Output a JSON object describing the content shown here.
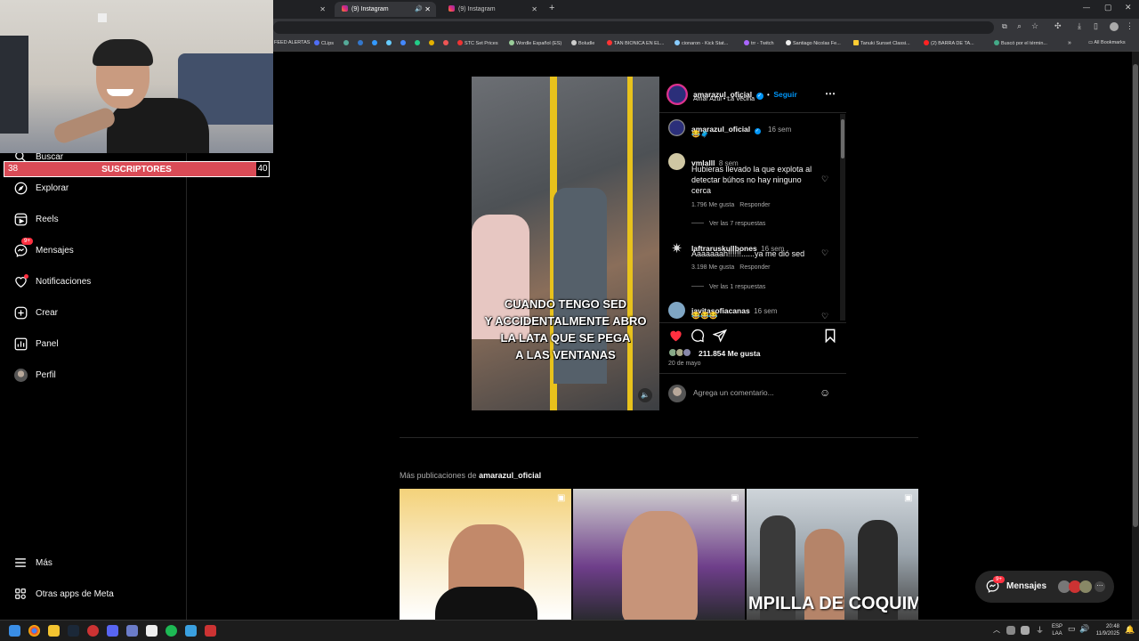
{
  "browser": {
    "tabs": [
      {
        "label": "",
        "active": false
      },
      {
        "label": "(9) Instagram",
        "active": true
      },
      {
        "label": "(9) Instagram",
        "active": false
      }
    ],
    "new_tab": "+",
    "bookmarks": [
      "FEED ALERTAS",
      "CLips",
      "STC Set Prices",
      "Wordle Español (ES)",
      "Boludle",
      "TAN BIONICA EN EL...",
      "cionaron - Kick Stat...",
      "trr - Twitch",
      "Santiago Nicolas Fe...",
      "Tanuki Sunset Classi...",
      "(2) BARRA DE TA...",
      "Buscó por el términ..."
    ],
    "all_bookmarks": "All Bookmarks"
  },
  "stream": {
    "subs_left": "38",
    "subs_label": "SUSCRIPTORES",
    "subs_right": "40"
  },
  "sidebar": {
    "items": [
      {
        "label": "Buscar",
        "icon": "search-icon"
      },
      {
        "label": "Explorar",
        "icon": "compass-icon"
      },
      {
        "label": "Reels",
        "icon": "reels-icon"
      },
      {
        "label": "Mensajes",
        "icon": "messenger-icon",
        "badge": "9+"
      },
      {
        "label": "Notificaciones",
        "icon": "heart-icon"
      },
      {
        "label": "Crear",
        "icon": "plus-square-icon"
      },
      {
        "label": "Panel",
        "icon": "dashboard-icon"
      },
      {
        "label": "Perfil",
        "icon": "avatar"
      }
    ],
    "more": "Más",
    "meta_apps": "Otras apps de Meta"
  },
  "post": {
    "video_caption": [
      "CUANDO TENGO SED",
      "Y ACCIDENTALMENTE ABRO",
      "LA LATA QUE SE PEGA",
      "A LAS VENTANAS"
    ],
    "author": "amarazul_oficial",
    "follow": "Seguir",
    "dot": "•",
    "audio": "Amar Azul • La Vecina",
    "caption_time": "16 sem",
    "caption_emojis": "😂🧳",
    "comments": [
      {
        "user": "vmlalll",
        "time": "8 sem",
        "text": "Hubieras llevado la que explota al detectar búhos no hay ninguno cerca",
        "likes": "1.796 Me gusta",
        "reply": "Responder",
        "replies": "Ver las 7 respuestas"
      },
      {
        "user": "laftraruskullbones",
        "time": "16 sem",
        "text": "Aaaaaaah!!!!!!......ya me dió sed",
        "likes": "3.198 Me gusta",
        "reply": "Responder",
        "replies": "Ver las 1 respuestas"
      },
      {
        "user": "javitasofiacanas",
        "time": "16 sem",
        "text": "😂😂😂"
      }
    ],
    "likes_total": "211.854 Me gusta",
    "date": "20 de mayo",
    "comment_placeholder": "Agrega un comentario..."
  },
  "more_posts": {
    "prefix": "Más publicaciones de",
    "user": "amarazul_oficial",
    "thumb3_text": "MPILLA DE COQUIMI"
  },
  "floating_messages": {
    "label": "Mensajes",
    "badge": "9+"
  },
  "taskbar": {
    "lang": "ESP",
    "lang2": "LAA",
    "time": "20:48",
    "date": "11/9/2025"
  },
  "colors": {
    "accent": "#0095f6",
    "like": "#ff3040",
    "badge": "#ff3040",
    "subs": "#d94b56"
  }
}
